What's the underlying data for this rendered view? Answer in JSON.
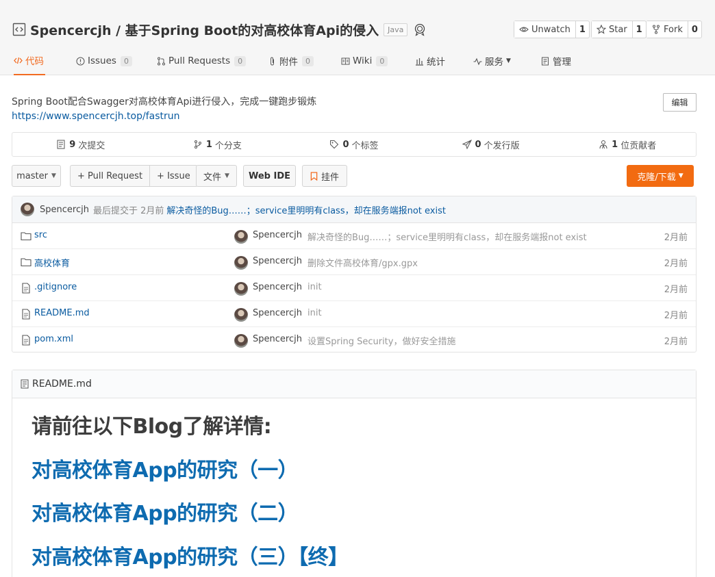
{
  "repo": {
    "title": "Spencercjh / 基于Spring Boot的对高校体育Api的侵入",
    "language": "Java",
    "unwatch_label": "Unwatch",
    "unwatch_count": "1",
    "star_label": "Star",
    "star_count": "1",
    "fork_label": "Fork",
    "fork_count": "0"
  },
  "tabs": {
    "code": "代码",
    "issues": "Issues",
    "issues_count": "0",
    "pull_requests": "Pull Requests",
    "pull_requests_count": "0",
    "attachments": "附件",
    "attachments_count": "0",
    "wiki": "Wiki",
    "wiki_count": "0",
    "stats": "统计",
    "services": "服务",
    "manage": "管理"
  },
  "description": {
    "text": "Spring Boot配合Swagger对高校体育Api进行侵入，完成一键跑步锻炼",
    "homepage": "https://www.spencercjh.top/fastrun",
    "edit_label": "编辑"
  },
  "stats": {
    "commits_count": "9",
    "commits_label": "次提交",
    "branches_count": "1",
    "branches_label": "个分支",
    "tags_count": "0",
    "tags_label": "个标签",
    "releases_count": "0",
    "releases_label": "个发行版",
    "contributors_count": "1",
    "contributors_label": "位贡献者"
  },
  "toolbar": {
    "branch": "master",
    "pull_request": "+ Pull Request",
    "issue": "+ Issue",
    "files": "文件",
    "web_ide": "Web IDE",
    "widget": "挂件",
    "clone": "克隆/下载"
  },
  "last_commit": {
    "author": "Spencercjh",
    "meta": "最后提交于 2月前",
    "message": "解决奇怪的Bug……；service里明明有class，却在服务端报not exist"
  },
  "files": [
    {
      "type": "folder",
      "name": "src",
      "author": "Spencercjh",
      "message": "解决奇怪的Bug……；service里明明有class，却在服务端报not exist",
      "date": "2月前"
    },
    {
      "type": "folder",
      "name": "高校体育",
      "author": "Spencercjh",
      "message": "删除文件高校体育/gpx.gpx",
      "date": "2月前"
    },
    {
      "type": "file",
      "name": ".gitignore",
      "author": "Spencercjh",
      "message": "init",
      "date": "2月前"
    },
    {
      "type": "file",
      "name": "README.md",
      "author": "Spencercjh",
      "message": "init",
      "date": "2月前"
    },
    {
      "type": "file",
      "name": "pom.xml",
      "author": "Spencercjh",
      "message": "设置Spring Security，做好安全措施",
      "date": "2月前"
    }
  ],
  "readme": {
    "filename": "README.md",
    "heading": "请前往以下Blog了解详情:",
    "links": [
      "对高校体育App的研究（一）",
      "对高校体育App的研究（二）",
      "对高校体育App的研究（三）【终】"
    ]
  },
  "colors": {
    "accent": "#f26b21",
    "link": "#0a5ba0",
    "clone_button": "#f26b11"
  },
  "icons": {
    "repo": "code-repo-icon",
    "watch": "eye-icon",
    "star": "star-icon",
    "fork": "fork-icon",
    "folder": "folder-icon",
    "file": "file-icon"
  }
}
